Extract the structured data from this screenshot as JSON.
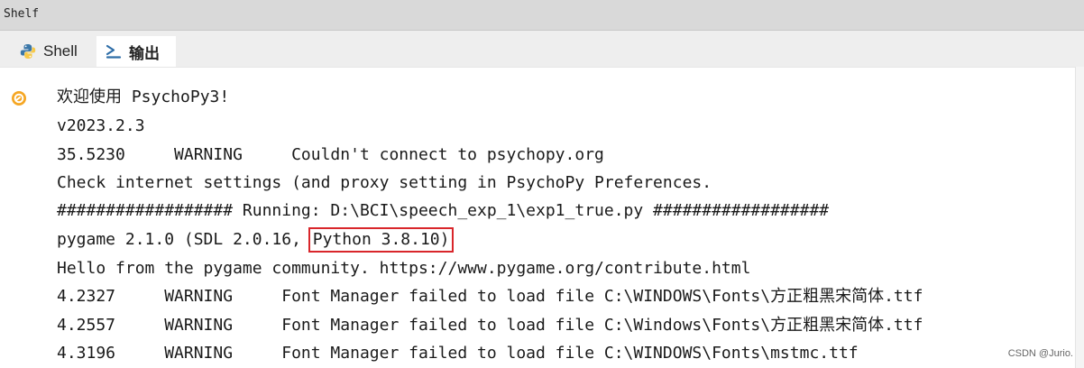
{
  "window": {
    "title": "Shelf"
  },
  "tabs": [
    {
      "label": "Shell",
      "icon": "python-icon",
      "active": false
    },
    {
      "label": "输出",
      "icon": "terminal-prompt-icon",
      "active": true
    }
  ],
  "output": {
    "gutter_icon": "run-status-icon",
    "lines": [
      "欢迎使用 PsychoPy3!",
      "v2023.2.3",
      "35.5230     WARNING     Couldn't connect to psychopy.org",
      "Check internet settings (and proxy setting in PsychoPy Preferences.",
      "################## Running: D:\\BCI\\speech_exp_1\\exp1_true.py ##################",
      "Hello from the pygame community. https://www.pygame.org/contribute.html",
      "4.2327     WARNING     Font Manager failed to load file C:\\WINDOWS\\Fonts\\方正粗黑宋简体.ttf",
      "4.2557     WARNING     Font Manager failed to load file C:\\Windows\\Fonts\\方正粗黑宋简体.ttf",
      "4.3196     WARNING     Font Manager failed to load file C:\\WINDOWS\\Fonts\\mstmc.ttf"
    ],
    "pygame_line": {
      "prefix": "pygame 2.1.0 (SDL 2.0.16, ",
      "highlighted": "Python 3.8.10)"
    }
  },
  "watermark": "CSDN @Jurio.",
  "colors": {
    "highlight_box": "#d9262b",
    "titlebar": "#d9d9d9",
    "tabbar": "#eeeeee",
    "run_icon": "#f5a623",
    "python_blue": "#3b77a8",
    "python_yellow": "#f7c948"
  }
}
